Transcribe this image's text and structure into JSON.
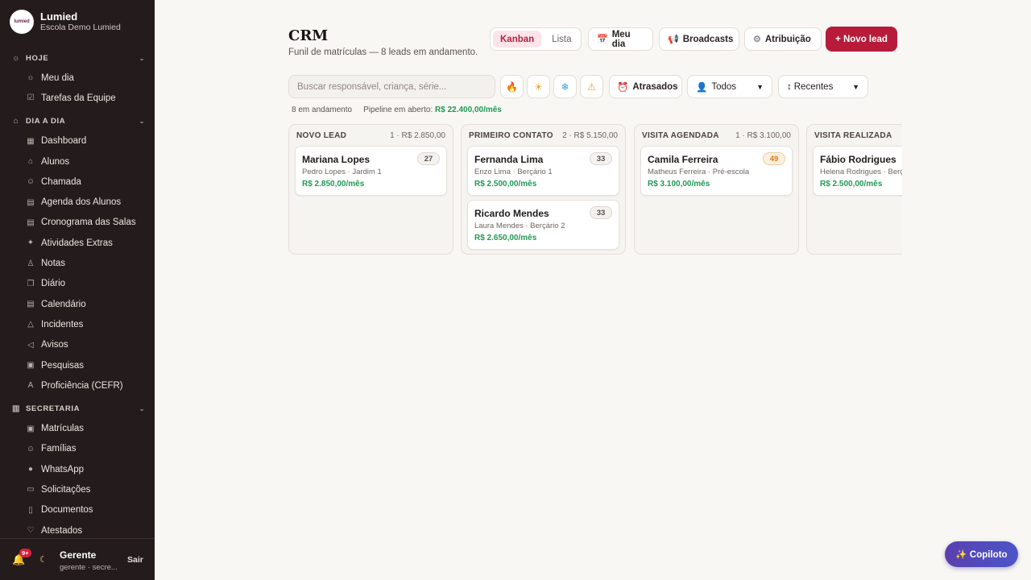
{
  "brand": {
    "name": "Lumied",
    "subtitle": "Escola Demo Lumied",
    "logo_text": "lumied"
  },
  "sidebar": {
    "sections": [
      {
        "label": "HOJE",
        "icon": "sun-icon",
        "items": [
          {
            "label": "Meu dia",
            "icon": "sun-icon"
          },
          {
            "label": "Tarefas da Equipe",
            "icon": "tasks-icon"
          }
        ]
      },
      {
        "label": "DIA A DIA",
        "icon": "graduation-icon",
        "items": [
          {
            "label": "Dashboard",
            "icon": "dashboard-icon"
          },
          {
            "label": "Alunos",
            "icon": "graduation-icon"
          },
          {
            "label": "Chamada",
            "icon": "user-check-icon"
          },
          {
            "label": "Agenda dos Alunos",
            "icon": "calendar-icon"
          },
          {
            "label": "Cronograma das Salas",
            "icon": "calendar-icon"
          },
          {
            "label": "Atividades Extras",
            "icon": "sparkles-icon"
          },
          {
            "label": "Notas",
            "icon": "award-icon"
          },
          {
            "label": "Diário",
            "icon": "book-icon"
          },
          {
            "label": "Calendário",
            "icon": "calendar-icon"
          },
          {
            "label": "Incidentes",
            "icon": "warning-icon"
          },
          {
            "label": "Avisos",
            "icon": "megaphone-icon"
          },
          {
            "label": "Pesquisas",
            "icon": "clipboard-icon"
          },
          {
            "label": "Proficiência (CEFR)",
            "icon": "language-icon"
          }
        ]
      },
      {
        "label": "SECRETARIA",
        "icon": "building-icon",
        "items": [
          {
            "label": "Matrículas",
            "icon": "clipboard-icon"
          },
          {
            "label": "Famílias",
            "icon": "users-icon"
          },
          {
            "label": "WhatsApp",
            "icon": "chat-icon"
          },
          {
            "label": "Solicitações",
            "icon": "message-icon"
          },
          {
            "label": "Documentos",
            "icon": "document-icon"
          },
          {
            "label": "Atestados",
            "icon": "stethoscope-icon"
          }
        ]
      }
    ],
    "footer": {
      "notifications_badge": "9+",
      "user_name": "Gerente",
      "user_role": "gerente · secre...",
      "logout_label": "Sair"
    }
  },
  "header": {
    "title": "CRM",
    "subtitle": "Funil de matrículas — 8 leads em andamento."
  },
  "toolbar": {
    "view_toggle": [
      "Kanban",
      "Lista"
    ],
    "active_view": "Kanban",
    "my_day_label": "Meu dia",
    "broadcasts_label": "Broadcasts",
    "attribution_label": "Atribuição",
    "new_lead_label": "+ Novo lead"
  },
  "filters": {
    "search_placeholder": "Buscar responsável, criança, série...",
    "temperature_chips": [
      "fire-icon",
      "sun-icon",
      "snowflake-icon",
      "warning-icon"
    ],
    "late_label": "Atrasados",
    "owner_select": "Todos",
    "sort_select": "Recentes"
  },
  "stats": {
    "in_progress": "8 em andamento",
    "pipeline_label": "Pipeline em aberto:",
    "pipeline_value": "R$ 22.400,00/mês"
  },
  "columns": [
    {
      "title": "NOVO LEAD",
      "meta": "1 · R$ 2.850,00",
      "cards": [
        {
          "name": "Mariana Lopes",
          "sub": "Pedro Lopes · Jardim 1",
          "price": "R$ 2.850,00/mês",
          "score": "27",
          "warm": false
        }
      ]
    },
    {
      "title": "PRIMEIRO CONTATO",
      "meta": "2 · R$ 5.150,00",
      "cards": [
        {
          "name": "Fernanda Lima",
          "sub": "Enzo Lima · Berçário 1",
          "price": "R$ 2.500,00/mês",
          "score": "33",
          "warm": false
        },
        {
          "name": "Ricardo Mendes",
          "sub": "Laura Mendes · Berçário 2",
          "price": "R$ 2.650,00/mês",
          "score": "33",
          "warm": false
        }
      ]
    },
    {
      "title": "VISITA AGENDADA",
      "meta": "1 · R$ 3.100,00",
      "cards": [
        {
          "name": "Camila Ferreira",
          "sub": "Matheus Ferreira · Pré-escola",
          "price": "R$ 3.100,00/mês",
          "score": "49",
          "warm": true
        }
      ]
    },
    {
      "title": "VISITA REALIZADA",
      "meta": "",
      "cards": [
        {
          "name": "Fábio Rodrigues",
          "sub": "Helena Rodrigues · Berçário",
          "price": "R$ 2.500,00/mês",
          "score": "",
          "warm": false
        }
      ]
    }
  ],
  "copilot_label": "✨ Copiloto"
}
